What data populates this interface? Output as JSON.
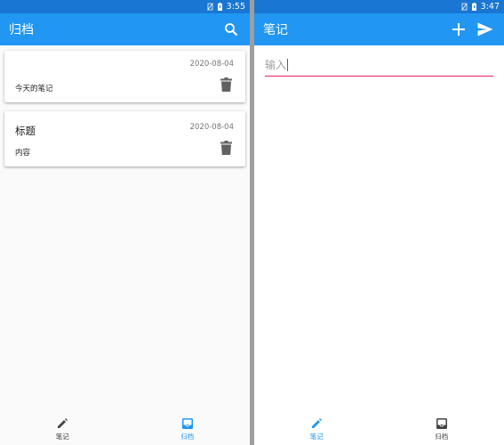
{
  "left_screen": {
    "statusbar": {
      "time": "3:55"
    },
    "appbar": {
      "title": "归档"
    },
    "notes": [
      {
        "title": "",
        "date": "2020-08-04",
        "content": "今天的笔记"
      },
      {
        "title": "标题",
        "date": "2020-08-04",
        "content": "内容"
      }
    ],
    "bottom_nav": [
      {
        "label": "笔记",
        "icon": "pencil-icon",
        "active": false
      },
      {
        "label": "归档",
        "icon": "inbox-icon",
        "active": true
      }
    ]
  },
  "right_screen": {
    "statusbar": {
      "time": "3:47"
    },
    "appbar": {
      "title": "笔记"
    },
    "input": {
      "placeholder": "输入",
      "value": ""
    },
    "bottom_nav": [
      {
        "label": "笔记",
        "icon": "pencil-icon",
        "active": true
      },
      {
        "label": "归档",
        "icon": "inbox-icon",
        "active": false
      }
    ]
  },
  "colors": {
    "statusbar": "#1976d2",
    "appbar": "#2196f3",
    "accent": "#e91e63",
    "nav_active": "#2196f3",
    "nav_inactive": "#424242"
  }
}
